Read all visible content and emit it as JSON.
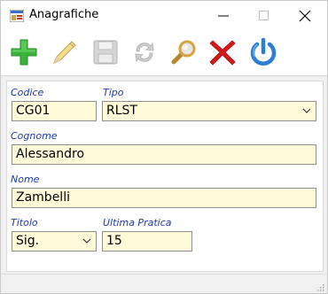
{
  "window": {
    "title": "Anagrafiche"
  },
  "toolbar": {
    "buttons": [
      {
        "icon": "add-icon",
        "name": "add-button"
      },
      {
        "icon": "edit-icon",
        "name": "edit-button"
      },
      {
        "icon": "save-icon",
        "name": "save-button"
      },
      {
        "icon": "refresh-icon",
        "name": "refresh-button"
      },
      {
        "icon": "search-icon",
        "name": "search-button"
      },
      {
        "icon": "delete-icon",
        "name": "delete-button"
      },
      {
        "icon": "power-icon",
        "name": "exit-button"
      }
    ]
  },
  "form": {
    "codice": {
      "label": "Codice",
      "value": "CG01"
    },
    "tipo": {
      "label": "Tipo",
      "value": "RLST"
    },
    "cognome": {
      "label": "Cognome",
      "value": "Alessandro"
    },
    "nome": {
      "label": "Nome",
      "value": "Zambelli"
    },
    "titolo": {
      "label": "Titolo",
      "value": "Sig."
    },
    "ultima_pratica": {
      "label": "Ultima Pratica",
      "value": "15"
    }
  },
  "colors": {
    "field_bg": "#fffbd9",
    "label": "#1c3aa9",
    "add_green": "#3cb43c",
    "delete_red": "#d81818",
    "power_blue": "#2a7fd4"
  }
}
